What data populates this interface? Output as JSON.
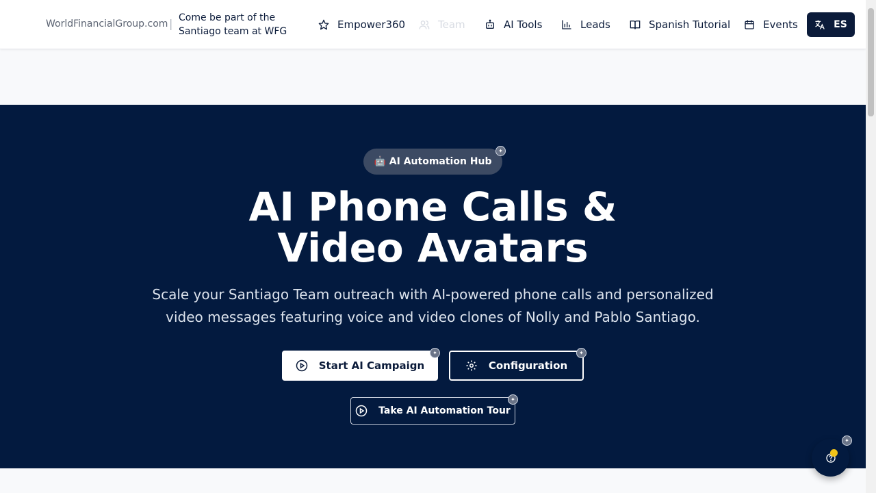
{
  "header": {
    "brand": "WorldFinancialGroup.com",
    "separator": "|",
    "tagline": "Come be part of the Santiago team at WFG",
    "nav": [
      {
        "label": "Empower360",
        "icon": "star-icon"
      },
      {
        "label": "Team",
        "icon": "users-icon",
        "disabled": true
      },
      {
        "label": "AI Tools",
        "icon": "bot-icon"
      },
      {
        "label": "Leads",
        "icon": "bar-chart-icon"
      },
      {
        "label": "Spanish Tutorial",
        "icon": "book-icon"
      },
      {
        "label": "Events",
        "icon": "calendar-icon"
      }
    ],
    "language_button": {
      "label": "ES",
      "icon": "translate-icon"
    }
  },
  "hero": {
    "badge": "🤖 AI Automation Hub",
    "title_line1": "AI Phone Calls &",
    "title_line2": "Video Avatars",
    "description": "Scale your Santiago Team outreach with AI-powered phone calls and personalized video messages featuring voice and video clones of Nolly and Pablo Santiago.",
    "buttons": {
      "start": "Start AI Campaign",
      "config": "Configuration",
      "tour": "Take AI Automation Tour"
    }
  },
  "colors": {
    "hero_bg": "#031a3f",
    "nav_text": "#0b1b3a",
    "accent_dot": "#f2c318"
  }
}
